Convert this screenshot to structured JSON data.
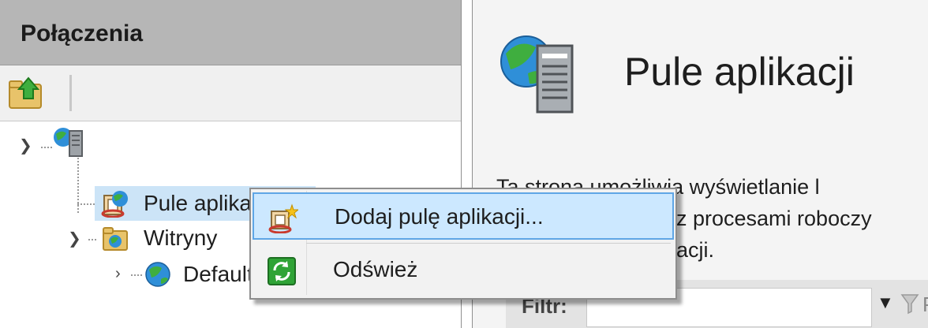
{
  "connections": {
    "title": "Połączenia",
    "tree": {
      "pools_label": "Pule aplikacji",
      "sites_label": "Witryny",
      "default_label": "Default Web Site"
    }
  },
  "main": {
    "title": "Pule aplikacji",
    "description_lines": [
      "Ta strona umożliwia wyświetlanie l",
      "z procesami roboczy",
      "acji."
    ],
    "filter_label": "Filtr:",
    "filter_action_fragment": "P"
  },
  "context_menu": {
    "items": [
      {
        "label": "Dodaj pulę aplikacji...",
        "icon": "add-app-pool-icon"
      },
      {
        "label": "Odśwież",
        "icon": "refresh-icon"
      }
    ]
  },
  "colors": {
    "selection": "#cce4f7",
    "menu_highlight": "#cce8ff",
    "menu_highlight_border": "#5fa6e6",
    "header": "#b6b6b6"
  }
}
